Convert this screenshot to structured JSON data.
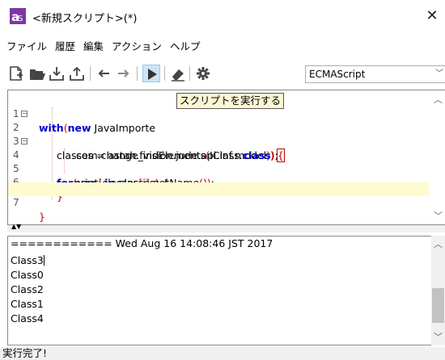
{
  "window": {
    "title": "<新規スクリプト>(*)",
    "close_symbol": "✕",
    "icon": "astah-script-icon"
  },
  "menu": {
    "items": [
      "ファイル",
      "履歴",
      "編集",
      "アクション",
      "ヘルプ"
    ]
  },
  "toolbar": {
    "buttons": [
      "new-script-icon",
      "open-folder-icon",
      "download-icon",
      "upload-icon",
      "back-arrow-icon",
      "forward-arrow-icon",
      "run-play-icon",
      "eraser-icon",
      "gear-icon"
    ],
    "language": "ECMAScript",
    "run_tooltip": "スクリプトを実行する"
  },
  "editor": {
    "line_numbers": [
      "1",
      "2",
      "3",
      "4",
      "5",
      "6",
      "7"
    ],
    "line1": {
      "kw1": "with",
      "p1": "(",
      "kw2": "new",
      "text": " JavaImporte"
    },
    "line2": {
      "text": "com.change_vision.jude.api.inf.model",
      "close": "))",
      "brace": "{"
    },
    "line3": {
      "text1": "classes = astah.findElements",
      "p1": "(",
      "text2": "IClass.",
      "kw": "class",
      "p2": ")",
      "text3": ";"
    },
    "line4": {
      "kw1": "for",
      "p1": "(",
      "kw2": "var",
      "text": " i ",
      "kw3": "in",
      "text2": " classes",
      "p2": ")",
      "brace": " {"
    },
    "line5": {
      "text1": "print",
      "p1": "(",
      "text2": "classes",
      "b1": "[",
      "text3": "i",
      "b2": "]",
      "text4": ".getName",
      "p2": "())",
      "text5": ";"
    },
    "line6": {
      "brace": "}"
    },
    "line7": {
      "brace": "}"
    }
  },
  "output": {
    "header": "============ Wed Aug 16 14:08:46 JST 2017",
    "lines": [
      "Class3",
      "Class0",
      "Class2",
      "Class1",
      "Class4"
    ]
  },
  "status": {
    "text": "実行完了!"
  }
}
